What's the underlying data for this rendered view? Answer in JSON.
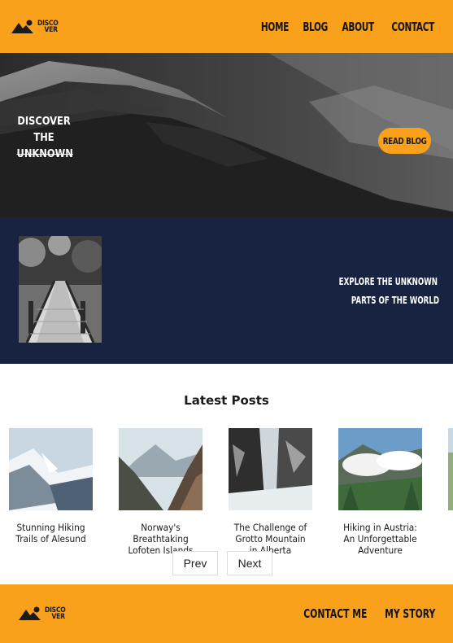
{
  "brand": {
    "line1": "DISCO",
    "line2": "VER"
  },
  "nav": [
    "HOME",
    "BLOG",
    "ABOUT",
    "CONTACT"
  ],
  "hero": {
    "title_lines": [
      "DISCOVER",
      "THE",
      "UNKNOWN"
    ],
    "button": "READ BLOG"
  },
  "banner": {
    "line1": "EXPLORE THE UNKNOWN",
    "line2": "PARTS OF THE WORLD"
  },
  "latest": {
    "heading": "Latest Posts",
    "posts": [
      {
        "title": "Stunning Hiking Trails of Alesund"
      },
      {
        "title": "Norway's Breathtaking Lofoten Islands"
      },
      {
        "title": "The Challenge of Grotto Mountain in Alberta"
      },
      {
        "title": "Hiking in Austria: An Unforgettable Adventure"
      }
    ],
    "prev": "Prev",
    "next": "Next"
  },
  "footer": {
    "links": [
      "CONTACT ME",
      "MY STORY"
    ]
  },
  "colors": {
    "accent": "#f9a11b",
    "navy": "#172341"
  }
}
